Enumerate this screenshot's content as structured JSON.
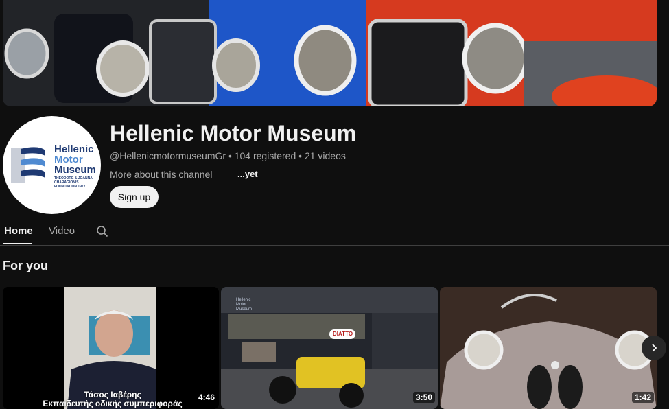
{
  "channel": {
    "name": "Hellenic Motor Museum",
    "handle": "@HellenicmotormuseumGr",
    "subscribers": "104 registered",
    "video_count": "21 videos",
    "separator": "•",
    "about_label": "More about this channel",
    "about_more": "...yet",
    "signup_label": "Sign up"
  },
  "avatar": {
    "line1": "Hellenic",
    "line2": "Motor",
    "line3": "Museum",
    "foundation": "THEODORE & JOANNA CHARAGIONIS FOUNDATION 1977"
  },
  "tabs": {
    "home": "Home",
    "video": "Video"
  },
  "section": {
    "title": "For you"
  },
  "videos": [
    {
      "duration": "4:46",
      "caption_line1": "Τάσος Ιαβέρης",
      "caption_line2": "Εκπαιδευτής οδικής συμπεριφοράς"
    },
    {
      "duration": "3:50",
      "logo_text": "Hellenic Motor Museum",
      "sign_text": "DIATTO"
    },
    {
      "duration": "1:42"
    }
  ],
  "icons": {
    "search": "search-icon",
    "next": "chevron-right-icon"
  }
}
